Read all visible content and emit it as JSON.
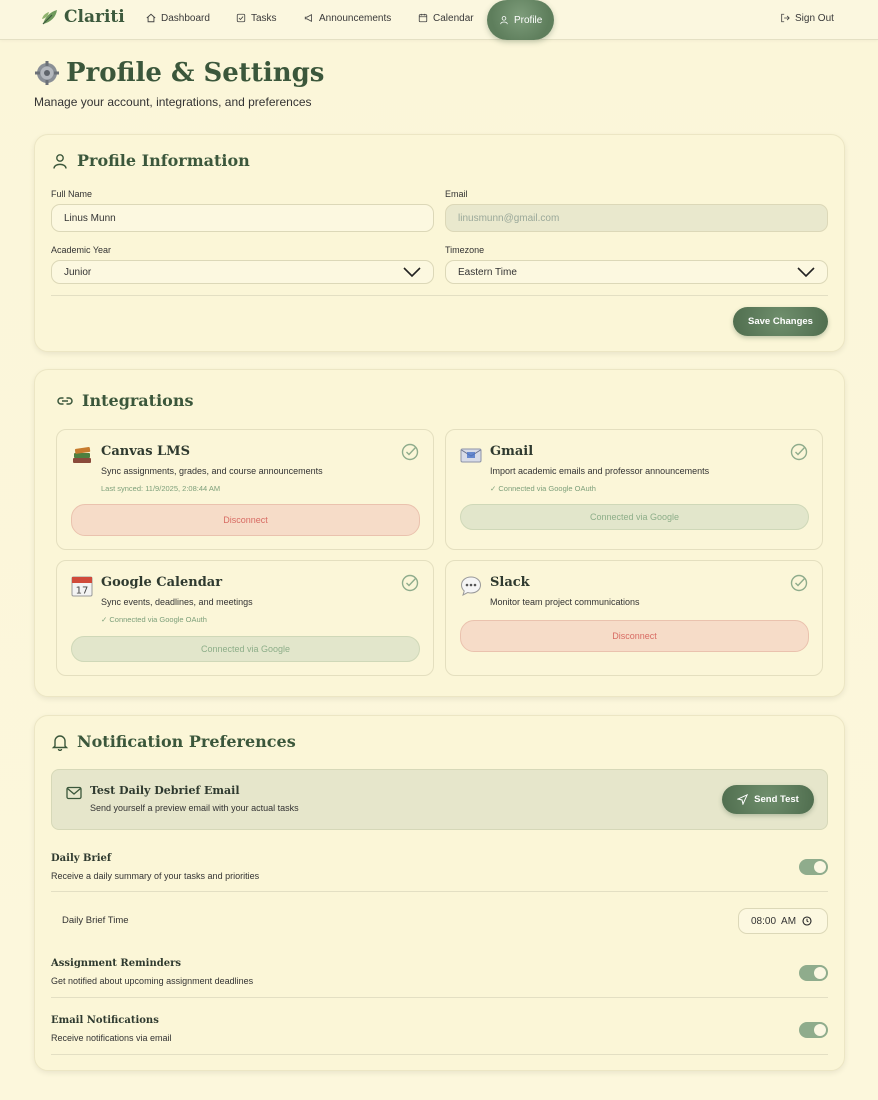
{
  "nav": {
    "brand": "Clariti",
    "items": [
      {
        "label": "Dashboard",
        "icon": "home-icon"
      },
      {
        "label": "Tasks",
        "icon": "checkbox-icon"
      },
      {
        "label": "Announcements",
        "icon": "megaphone-icon"
      },
      {
        "label": "Calendar",
        "icon": "calendar-icon"
      },
      {
        "label": "Profile",
        "icon": "user-icon"
      }
    ],
    "signout": "Sign Out"
  },
  "page": {
    "title": "Profile & Settings",
    "subtitle": "Manage your account, integrations, and preferences"
  },
  "profile": {
    "heading": "Profile Information",
    "full_name_label": "Full Name",
    "full_name_value": "Linus Munn",
    "email_label": "Email",
    "email_value": "linusmunn@gmail.com",
    "year_label": "Academic Year",
    "year_value": "Junior",
    "timezone_label": "Timezone",
    "timezone_value": "Eastern Time",
    "save_label": "Save Changes"
  },
  "integrations": {
    "heading": "Integrations",
    "tiles": [
      {
        "name": "Canvas LMS",
        "desc": "Sync assignments, grades, and course announcements",
        "meta": "Last synced: 11/9/2025, 2:08:44 AM",
        "button": "Disconnect",
        "icon": "books-icon"
      },
      {
        "name": "Gmail",
        "desc": "Import academic emails and professor announcements",
        "meta": "✓ Connected via Google OAuth",
        "button": "Connected via Google",
        "icon": "envelope-icon"
      },
      {
        "name": "Google Calendar",
        "desc": "Sync events, deadlines, and meetings",
        "meta": "✓ Connected via Google OAuth",
        "button": "Connected via Google",
        "icon": "calendar-icon",
        "day": "17"
      },
      {
        "name": "Slack",
        "desc": "Monitor team project communications",
        "meta": "",
        "button": "Disconnect",
        "icon": "speech-bubble-icon"
      }
    ]
  },
  "notifications": {
    "heading": "Notification Preferences",
    "test_title": "Test Daily Debrief Email",
    "test_desc": "Send yourself a preview email with your actual tasks",
    "send_test": "Send Test",
    "daily_brief_title": "Daily Brief",
    "daily_brief_desc": "Receive a daily summary of your tasks and priorities",
    "daily_brief_time_label": "Daily Brief Time",
    "daily_brief_time": "08:00  AM",
    "reminders_title": "Assignment Reminders",
    "reminders_desc": "Get notified about upcoming assignment deadlines",
    "email_title": "Email Notifications",
    "email_desc": "Receive notifications via email"
  },
  "colors": {
    "accent": "#4f6d4e",
    "background": "#fbf6d9",
    "danger": "#d86b63"
  }
}
